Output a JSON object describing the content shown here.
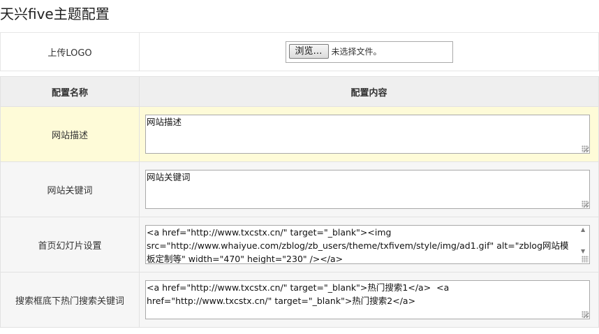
{
  "page": {
    "title": "天兴five主题配置"
  },
  "upload": {
    "label": "上传LOGO",
    "browse_label": "浏览…",
    "status": "未选择文件。"
  },
  "table": {
    "headers": {
      "name": "配置名称",
      "content": "配置内容"
    },
    "rows": [
      {
        "name": "网站描述",
        "value": "网站描述"
      },
      {
        "name": "网站关键词",
        "value": "网站关键词"
      },
      {
        "name": "首页幻灯片设置",
        "value": "<a href=\"http://www.txcstx.cn/\" target=\"_blank\"><img src=\"http://www.whaiyue.com/zblog/zb_users/theme/txfivem/style/img/ad1.gif\" alt=\"zblog网站模板定制等\" width=\"470\" height=\"230\" /></a>"
      },
      {
        "name": "搜索框底下热门搜索关键词",
        "value": "<a href=\"http://www.txcstx.cn/\" target=\"_blank\">热门搜索1</a>  <a href=\"http://www.txcstx.cn/\" target=\"_blank\">热门搜索2</a>"
      }
    ]
  }
}
